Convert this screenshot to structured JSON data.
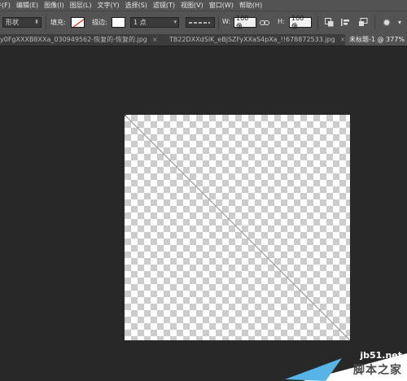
{
  "menu": [
    "件(F)",
    "编辑(E)",
    "图像(I)",
    "图层(L)",
    "文字(Y)",
    "选择(S)",
    "滤镜(T)",
    "视图(V)",
    "窗口(W)",
    "帮助(H)"
  ],
  "options": {
    "mode": "形状",
    "fill_label": "填充:",
    "stroke_label": "描边:",
    "stroke_width": "1 点",
    "w_label": "W:",
    "w_value": "100 像",
    "h_label": "H:",
    "h_value": "100 像"
  },
  "tabs": [
    {
      "label": "y0FgXXXB8XXa_030949562-恢复的-恢复的.jpg",
      "active": false
    },
    {
      "label": "TB22DXXdSlK_eBjSZFyXXaS4pXa_!!678872533.jpg",
      "active": false
    },
    {
      "label": "未标题-1 @ 377%",
      "active": true
    }
  ],
  "icons": {
    "link": "link-icon",
    "align": "path-align-icon",
    "settings": "gear-icon"
  },
  "watermark": {
    "url": "jb51.net",
    "site": "脚本之家"
  }
}
